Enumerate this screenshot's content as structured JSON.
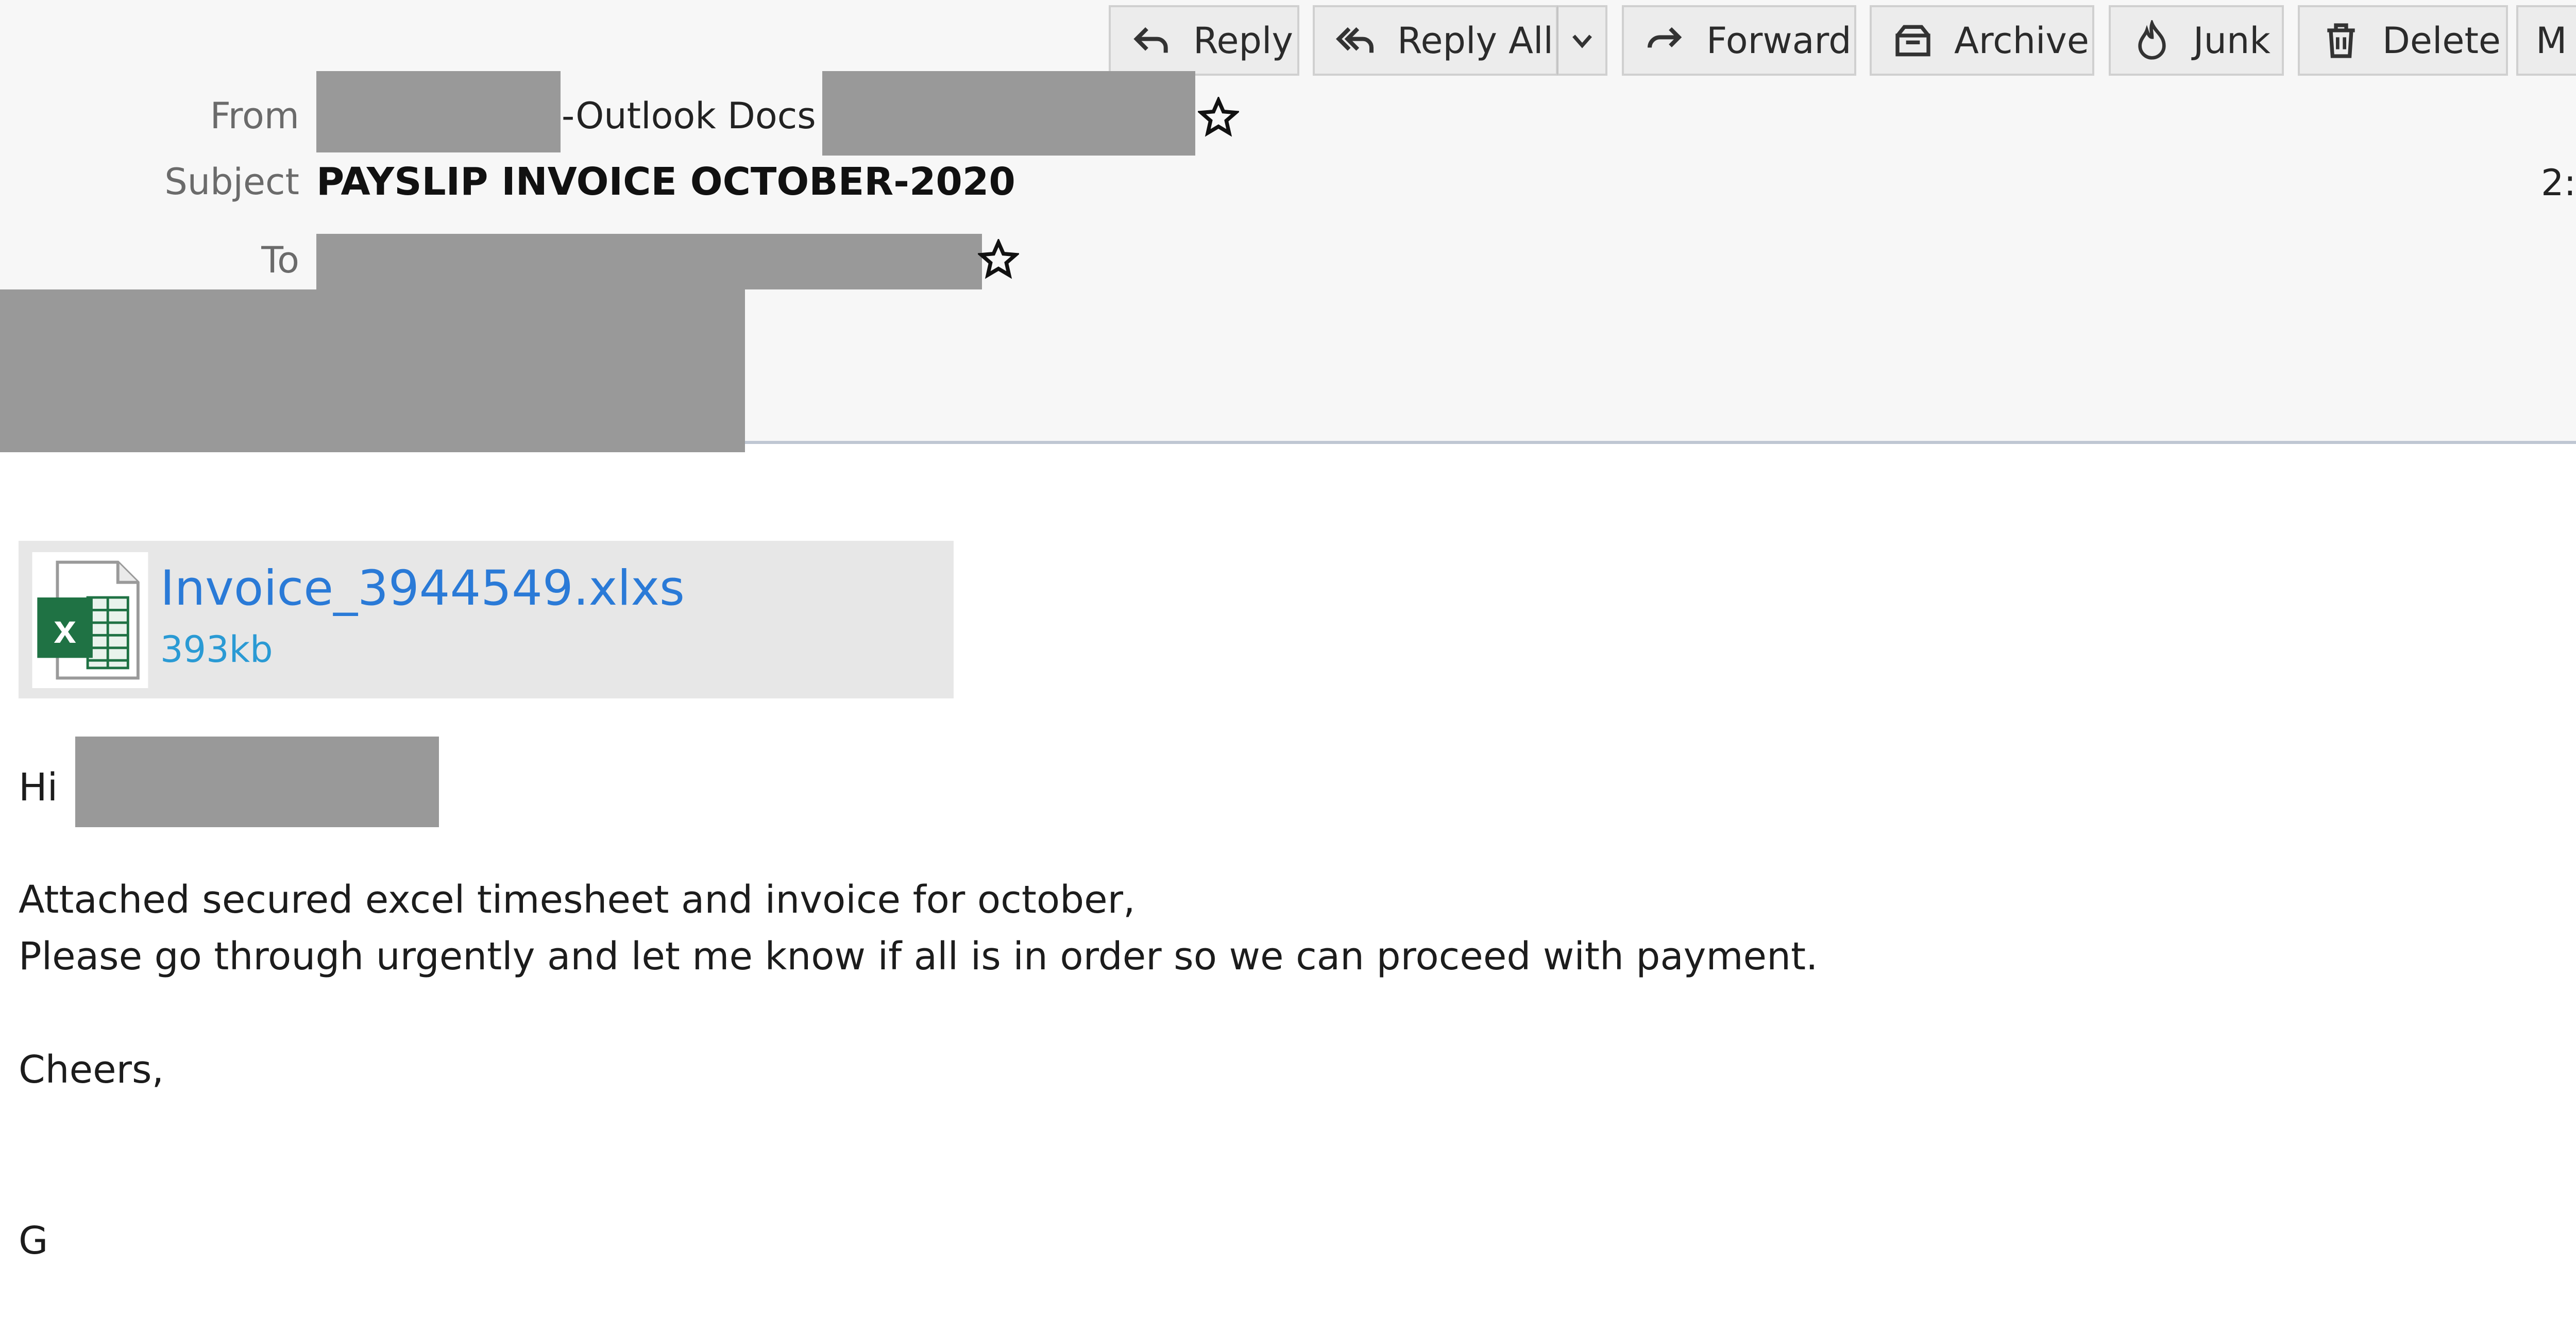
{
  "toolbar": {
    "reply": "Reply",
    "reply_all": "Reply All",
    "forward": "Forward",
    "archive": "Archive",
    "junk": "Junk",
    "delete": "Delete",
    "more": "M"
  },
  "header": {
    "from_label": "From",
    "from_text": "-Outlook Docs <",
    "subject_label": "Subject",
    "subject": "PAYSLIP INVOICE OCTOBER-2020",
    "to_label": "To",
    "date_partial": "2:"
  },
  "attachment": {
    "name": "Invoice_3944549.xlxs",
    "size": "393kb",
    "icon": "excel-file-icon"
  },
  "body": {
    "greeting": "Hi",
    "line1": "Attached secured excel timesheet and  invoice for october,",
    "line2": "Please go through urgently and let me know if all is in order so we can proceed with payment.",
    "signoff": "Cheers,",
    "signature": "G"
  },
  "colors": {
    "link": "#2a7ad7",
    "redaction": "#999999",
    "header_bg": "#f7f7f7"
  }
}
